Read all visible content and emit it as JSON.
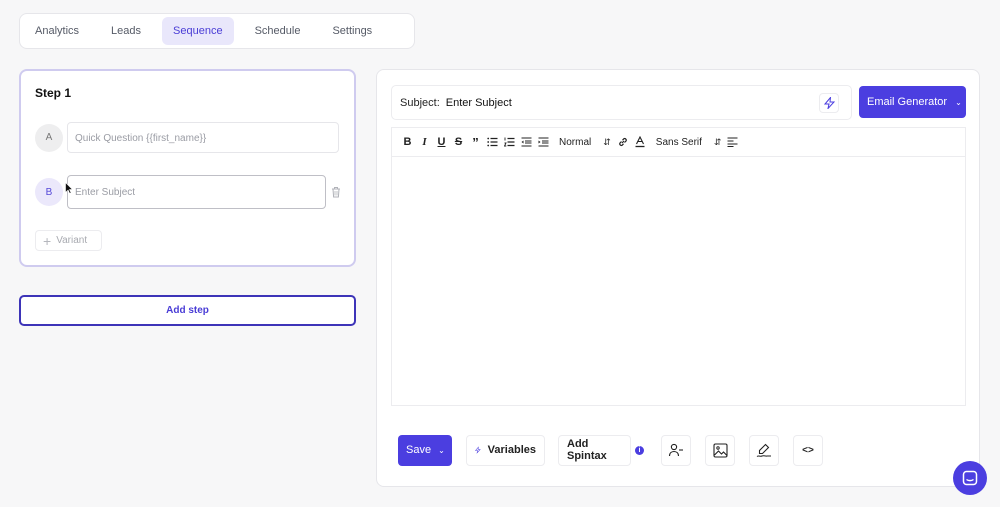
{
  "tabs": [
    {
      "label": "Analytics"
    },
    {
      "label": "Leads"
    },
    {
      "label": "Sequence",
      "active": true
    },
    {
      "label": "Schedule"
    },
    {
      "label": "Settings"
    }
  ],
  "step": {
    "title": "Step 1",
    "variants": [
      {
        "letter": "A",
        "value": "Quick Question {{first_name}}"
      },
      {
        "letter": "B",
        "placeholder": "Enter Subject"
      }
    ],
    "add_variant_label": "Variant"
  },
  "add_step_label": "Add step",
  "editor": {
    "subject_label": "Subject:",
    "subject_value": "Enter Subject",
    "email_generator_label": "Email Generator",
    "toolbar": {
      "bold": "B",
      "italic": "I",
      "underline": "U",
      "strike": "S",
      "quote": "”",
      "size_select": "Normal",
      "font_select": "Sans Serif"
    },
    "bottom": {
      "save_label": "Save",
      "variables_label": "Variables",
      "spintax_label": "Add Spintax",
      "info_label": "i",
      "code_label": "<>"
    }
  },
  "colors": {
    "accent": "#4b3ee0",
    "accent_light": "#e9e7fb",
    "border": "#e6e6ea"
  }
}
